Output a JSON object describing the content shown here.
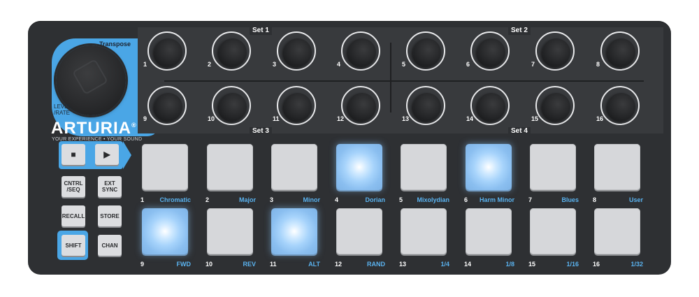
{
  "transpose_label": "Transpose",
  "level_label_1": "LEVEL",
  "level_label_2": "/RATE",
  "brand": "ARTURIA",
  "brand_mark": "®",
  "tagline": "YOUR EXPERIENCE • YOUR SOUND",
  "sets": [
    "Set 1",
    "Set 2",
    "Set 3",
    "Set 4"
  ],
  "knobs": [
    "1",
    "2",
    "3",
    "4",
    "5",
    "6",
    "7",
    "8",
    "9",
    "10",
    "11",
    "12",
    "13",
    "14",
    "15",
    "16"
  ],
  "buttons": {
    "stop_glyph": "■",
    "play_glyph": "▶",
    "cntrl_seq_1": "CNTRL",
    "cntrl_seq_2": "/SEQ",
    "ext_sync_1": "EXT",
    "ext_sync_2": "SYNC",
    "recall": "RECALL",
    "store": "STORE",
    "shift": "SHIFT",
    "chan": "CHAN"
  },
  "pads": [
    {
      "num": "1",
      "name": "Chromatic",
      "lit": false
    },
    {
      "num": "2",
      "name": "Major",
      "lit": false
    },
    {
      "num": "3",
      "name": "Minor",
      "lit": false
    },
    {
      "num": "4",
      "name": "Dorian",
      "lit": true
    },
    {
      "num": "5",
      "name": "Mixolydian",
      "lit": false
    },
    {
      "num": "6",
      "name": "Harm Minor",
      "lit": true
    },
    {
      "num": "7",
      "name": "Blues",
      "lit": false
    },
    {
      "num": "8",
      "name": "User",
      "lit": false
    },
    {
      "num": "9",
      "name": "FWD",
      "lit": true
    },
    {
      "num": "10",
      "name": "REV",
      "lit": false
    },
    {
      "num": "11",
      "name": "ALT",
      "lit": true
    },
    {
      "num": "12",
      "name": "RAND",
      "lit": false
    },
    {
      "num": "13",
      "name": "1/4",
      "lit": false
    },
    {
      "num": "14",
      "name": "1/8",
      "lit": false
    },
    {
      "num": "15",
      "name": "1/16",
      "lit": false
    },
    {
      "num": "16",
      "name": "1/32",
      "lit": false
    }
  ],
  "colors": {
    "accent": "#4aa6e6",
    "body": "#2e3033",
    "pad_label": "#5ab3f0"
  }
}
